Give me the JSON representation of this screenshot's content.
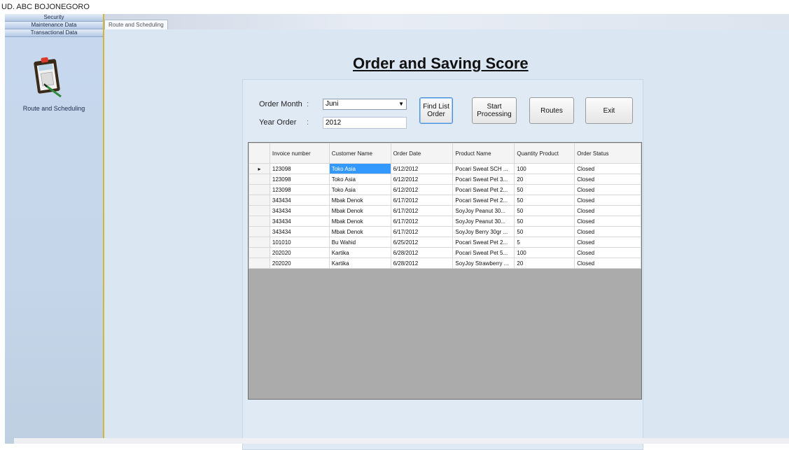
{
  "app": {
    "title": "UD. ABC BOJONEGORO"
  },
  "sidebar": {
    "menu": [
      "Security",
      "Maintenance Data",
      "Transactional Data"
    ],
    "nav_item": {
      "label": "Route and Scheduling",
      "icon": "clipboard-calculator-icon"
    }
  },
  "tabs": [
    {
      "label": "Route and Scheduling",
      "active": true
    }
  ],
  "page": {
    "title": "Order and Saving Score"
  },
  "form": {
    "order_month_label": "Order Month",
    "order_month_value": "Juni",
    "year_order_label": "Year Order",
    "year_order_value": "2012",
    "colon": ":"
  },
  "buttons": {
    "find_list_order": "Find List Order",
    "start_processing": "Start Processing",
    "routes": "Routes",
    "exit": "Exit"
  },
  "grid": {
    "columns": [
      "Invoice number",
      "Customer Name",
      "Order Date",
      "Product Name",
      "Quantity Product",
      "Order Status"
    ],
    "rows": [
      [
        "123098",
        "Toko Asia",
        "6/12/2012",
        "Pocari Sweat SCH ...",
        "100",
        "Closed"
      ],
      [
        "123098",
        "Toko Asia",
        "6/12/2012",
        "Pocari Sweat Pet 3...",
        "20",
        "Closed"
      ],
      [
        "123098",
        "Toko Asia",
        "6/12/2012",
        "Pocari Sweat Pet 2...",
        "50",
        "Closed"
      ],
      [
        "343434",
        "Mbak Denok",
        "6/17/2012",
        "Pocari Sweat Pet 2...",
        "50",
        "Closed"
      ],
      [
        "343434",
        "Mbak Denok",
        "6/17/2012",
        "SoyJoy Peanut 30...",
        "50",
        "Closed"
      ],
      [
        "343434",
        "Mbak Denok",
        "6/17/2012",
        "SoyJoy Peanut 30...",
        "50",
        "Closed"
      ],
      [
        "343434",
        "Mbak Denok",
        "6/17/2012",
        "SoyJoy Berry 30gr ...",
        "50",
        "Closed"
      ],
      [
        "101010",
        "Bu Wahid",
        "6/25/2012",
        "Pocari Sweat Pet 2...",
        "5",
        "Closed"
      ],
      [
        "202020",
        "Kartika",
        "6/28/2012",
        "Pocari Sweat Pet 5...",
        "100",
        "Closed"
      ],
      [
        "202020",
        "Kartika",
        "6/28/2012",
        "SoyJoy Strawberry ...",
        "20",
        "Closed"
      ]
    ],
    "current_row_marker": "▸"
  },
  "colors": {
    "selection": "#3399ff",
    "sidebar_border": "#d2b63c",
    "content_bg": "#dae6f2",
    "grid_empty": "#ababab"
  }
}
